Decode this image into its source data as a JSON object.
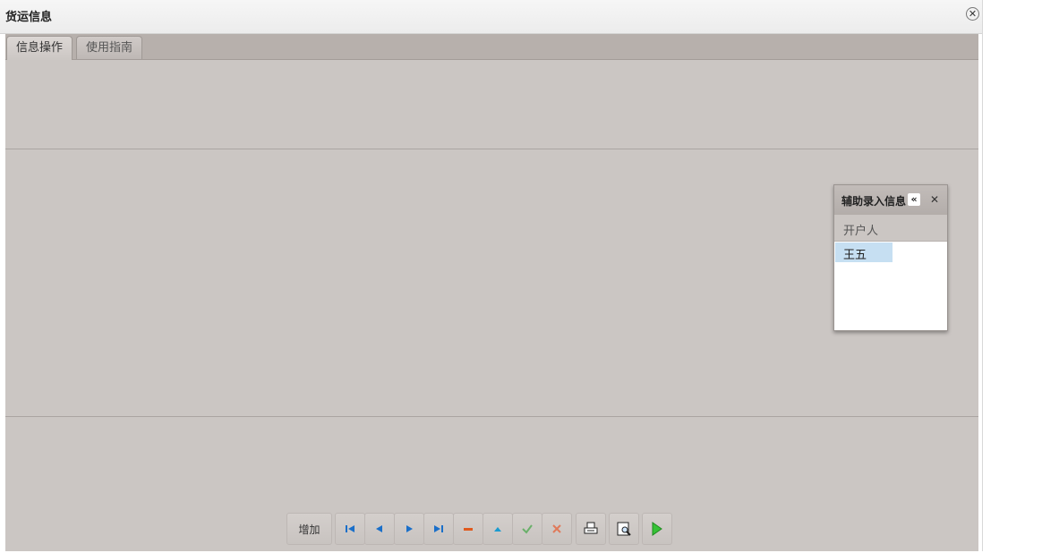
{
  "window": {
    "title": "货运信息"
  },
  "tabs": [
    {
      "label": "信息操作",
      "active": true
    },
    {
      "label": "使用指南",
      "active": false
    }
  ],
  "toolbar": {
    "add_label": "增加",
    "icons": [
      "first-icon",
      "prev-icon",
      "next-icon",
      "last-icon",
      "delete-icon",
      "up-icon",
      "confirm-icon",
      "cancel-icon",
      "print-icon",
      "print-preview-icon",
      "run-icon"
    ]
  },
  "popup": {
    "title": "辅助录入信息",
    "column_header": "开户人",
    "rows": [
      "王五"
    ]
  },
  "colors": {
    "panel_bg": "#cbc6c3",
    "selected_row": "#c6dff2",
    "accent_blue": "#1a6fc9",
    "delete_red": "#e05a1e",
    "confirm_green": "#6ab06a",
    "run_green": "#36c236"
  }
}
